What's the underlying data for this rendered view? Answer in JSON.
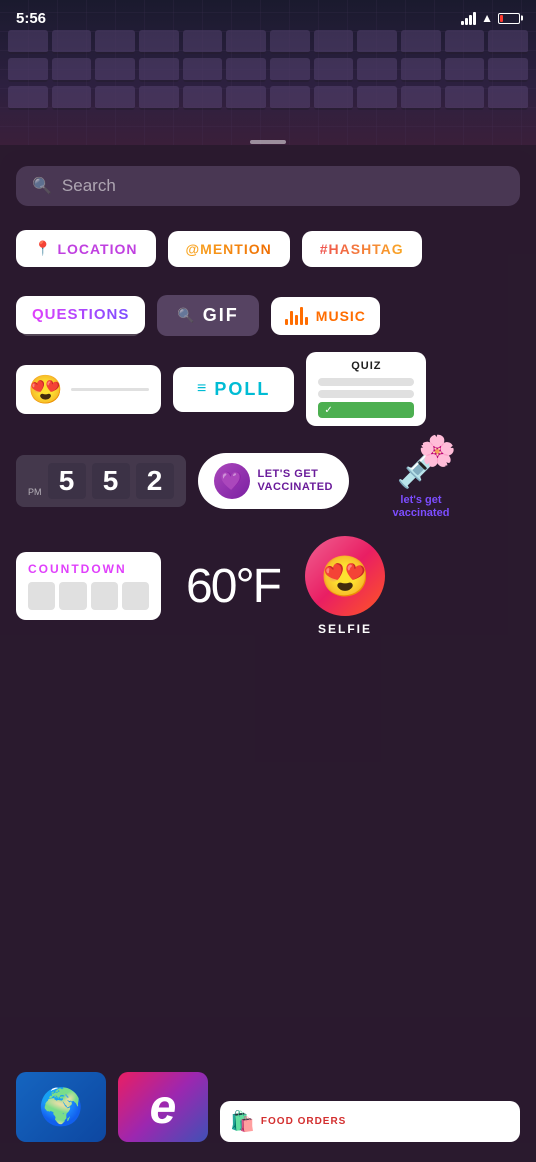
{
  "statusBar": {
    "time": "5:56",
    "signalBars": [
      4,
      7,
      10,
      13
    ],
    "batteryPercent": 15
  },
  "search": {
    "placeholder": "Search"
  },
  "stickers": {
    "row1": [
      {
        "id": "location",
        "icon": "📍",
        "text": "LOCATION"
      },
      {
        "id": "mention",
        "text": "@MENTION"
      },
      {
        "id": "hashtag",
        "text": "#HASHTAG"
      }
    ],
    "row2": [
      {
        "id": "questions",
        "text": "QUESTIONS"
      },
      {
        "id": "gif",
        "text": "GIF"
      },
      {
        "id": "music",
        "text": "MUSIC"
      }
    ],
    "row3": [
      {
        "id": "emoji",
        "emoji": "😍"
      },
      {
        "id": "poll",
        "text": "POLL"
      },
      {
        "id": "quiz",
        "title": "QUIZ"
      }
    ],
    "row4": [
      {
        "id": "clock",
        "pm": "PM",
        "digits": [
          "5",
          "5",
          "2"
        ]
      },
      {
        "id": "vaccinated",
        "text": "LET'S GET VACCINATED"
      },
      {
        "id": "vacc-illus",
        "caption": "let's get\nvaccinated"
      }
    ],
    "row5": [
      {
        "id": "countdown",
        "title": "COUNTDOWN"
      },
      {
        "id": "temperature",
        "value": "60°F"
      },
      {
        "id": "selfie",
        "label": "SELFIE"
      }
    ],
    "row6": [
      {
        "id": "globe"
      },
      {
        "id": "letter-e",
        "letter": "e"
      },
      {
        "id": "food-orders",
        "text": "FOOD ORDERS"
      }
    ]
  }
}
